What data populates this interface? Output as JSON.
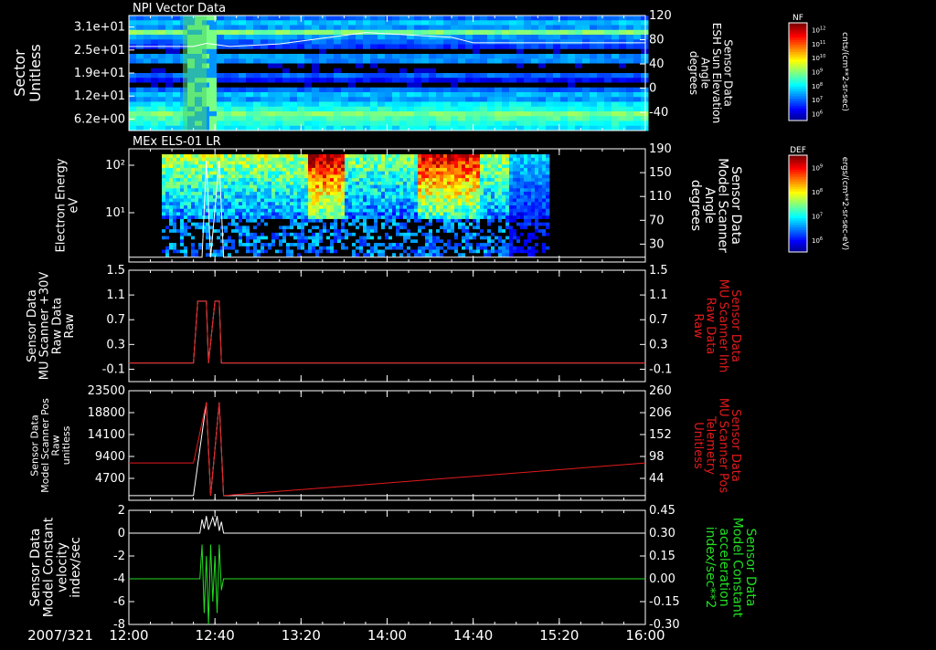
{
  "date_label": "2007/321",
  "time_ticks": [
    "12:00",
    "12:40",
    "13:20",
    "14:00",
    "14:40",
    "15:20",
    "16:00"
  ],
  "colors": {
    "white": "#ffffff",
    "red": "#e41a1c",
    "green": "#22dd22"
  },
  "colorbars": [
    {
      "title": "NF",
      "ticks": [
        "10^12",
        "10^11",
        "10^10",
        "10^9",
        "10^8",
        "10^7",
        "10^6"
      ],
      "unit": "cnts/(cm**2-sr-sec)"
    },
    {
      "title": "DEF",
      "ticks": [
        "10^9",
        "10^8",
        "10^7",
        "10^6"
      ],
      "unit": "ergs/(cm**2-sr-sec-eV)"
    }
  ],
  "chart_data": [
    {
      "type": "heatmap",
      "title": "NPI Vector Data",
      "ylabel": "Sector\nUnitless",
      "yticks": [
        "3.1e+01",
        "2.5e+01",
        "1.9e+01",
        "1.2e+01",
        "6.2e+00"
      ],
      "y2label": "Sensor Data\nESH Sun Elevation\nAngle\ndegrees",
      "y2ticks": [
        "120",
        "80",
        "40",
        "0",
        "-40"
      ],
      "y2lim": [
        -70,
        120
      ],
      "overlay_line": {
        "name": "ESH Sun Elevation Angle",
        "x": [
          "12:00",
          "12:30",
          "12:36",
          "12:47",
          "13:10",
          "13:50",
          "14:30",
          "14:40",
          "16:00"
        ],
        "y": [
          69,
          69,
          74,
          69,
          73,
          92,
          84,
          75,
          75
        ]
      }
    },
    {
      "type": "heatmap",
      "title": "MEx ELS-01 LR",
      "ylabel": "Electron Energy\neV",
      "yticks": [
        "10^2",
        "10^1"
      ],
      "y2label": "Sensor Data\nModel Scanner\nAngle\ndegrees",
      "y2ticks": [
        "190",
        "150",
        "110",
        "70",
        "30"
      ],
      "y2lim": [
        0,
        190
      ],
      "overlay_line": {
        "name": "Model Scanner Angle",
        "x": [
          "12:00",
          "12:34",
          "12:36",
          "12:38",
          "12:42",
          "12:44",
          "12:46",
          "16:00"
        ],
        "y": [
          8,
          8,
          170,
          8,
          170,
          8,
          8,
          8
        ]
      }
    },
    {
      "type": "line",
      "ylabel": "Sensor Data\nMU Scanner +30V\nRaw Data\nRaw",
      "ylim": [
        -0.3,
        1.5
      ],
      "yticks": [
        "1.5",
        "1.1",
        "0.7",
        "0.3",
        "-0.1"
      ],
      "y2label": "Sensor Data\nMU Scanner Inh\nRaw Data\nRaw",
      "y2ticks": [
        "1.5",
        "1.1",
        "0.7",
        "0.3",
        "-0.1"
      ],
      "series": [
        {
          "name": "MU Scanner +30V",
          "color": "white",
          "x": [
            "12:00",
            "12:30",
            "12:32",
            "12:36",
            "12:37",
            "12:40",
            "12:42",
            "12:43",
            "12:46",
            "16:00"
          ],
          "y": [
            0,
            0,
            1,
            1,
            0,
            1,
            1,
            0,
            0,
            0
          ]
        },
        {
          "name": "MU Scanner Inh",
          "color": "red",
          "x": [
            "12:00",
            "12:30",
            "12:32",
            "12:36",
            "12:37",
            "12:40",
            "12:42",
            "12:43",
            "12:46",
            "16:00"
          ],
          "y": [
            0,
            0,
            1,
            1,
            0,
            1,
            1,
            0,
            0,
            0
          ]
        }
      ]
    },
    {
      "type": "line",
      "ylabel": "Sensor Data\nModel Scanner Pos\nRaw\nunitless",
      "ylim": [
        0,
        23500
      ],
      "yticks": [
        "23500",
        "18800",
        "14100",
        "9400",
        "4700"
      ],
      "y2label": "Sensor Data\nMU Scanner Pos\nTelemetry\nUnitless",
      "y2ticks": [
        "260",
        "206",
        "152",
        "98",
        "44"
      ],
      "series": [
        {
          "name": "Model Scanner Pos",
          "color": "white",
          "x": [
            "12:00",
            "12:30",
            "12:36",
            "12:38",
            "12:42",
            "12:44",
            "16:00"
          ],
          "y": [
            1000,
            1000,
            21000,
            1000,
            21000,
            1000,
            1000
          ]
        },
        {
          "name": "MU Scanner Pos Telemetry",
          "color": "red",
          "x": [
            "12:00",
            "12:30",
            "12:36",
            "12:38",
            "12:42",
            "12:44",
            "16:00"
          ],
          "y": [
            8000,
            8000,
            21000,
            1000,
            21000,
            1000,
            8000
          ]
        }
      ]
    },
    {
      "type": "line",
      "ylabel": "Sensor Data\nModel Constant\nvelocity\nindex/sec",
      "ylim": [
        -8,
        2
      ],
      "yticks": [
        "2",
        "0",
        "-2",
        "-4",
        "-6",
        "-8"
      ],
      "y2label": "Sensor Data\nModel Constant\nacceleration\nindex/sec**2",
      "y2ticks": [
        "0.45",
        "0.30",
        "0.15",
        "0.00",
        "-0.15",
        "-0.30"
      ],
      "series": [
        {
          "name": "Model Constant velocity",
          "color": "white",
          "x": [
            "12:00",
            "12:33",
            "12:34",
            "12:35",
            "12:36",
            "12:37",
            "12:39",
            "12:40",
            "12:41",
            "12:42",
            "12:43",
            "12:44",
            "16:00"
          ],
          "y": [
            0,
            0,
            1.2,
            0.4,
            1.5,
            0.3,
            1.4,
            0.6,
            1.5,
            0.2,
            1.0,
            0,
            0
          ]
        },
        {
          "name": "Model Constant acceleration",
          "color": "green",
          "x": [
            "12:00",
            "12:33",
            "12:34",
            "12:35",
            "12:36",
            "12:37",
            "12:38",
            "12:39",
            "12:40",
            "12:41",
            "12:42",
            "12:43",
            "12:44",
            "16:00"
          ],
          "y": [
            -4,
            -4,
            -1,
            -7,
            -2,
            -8,
            -1,
            -6,
            -2,
            -7,
            -1,
            -5,
            -4,
            -4
          ]
        }
      ]
    }
  ]
}
